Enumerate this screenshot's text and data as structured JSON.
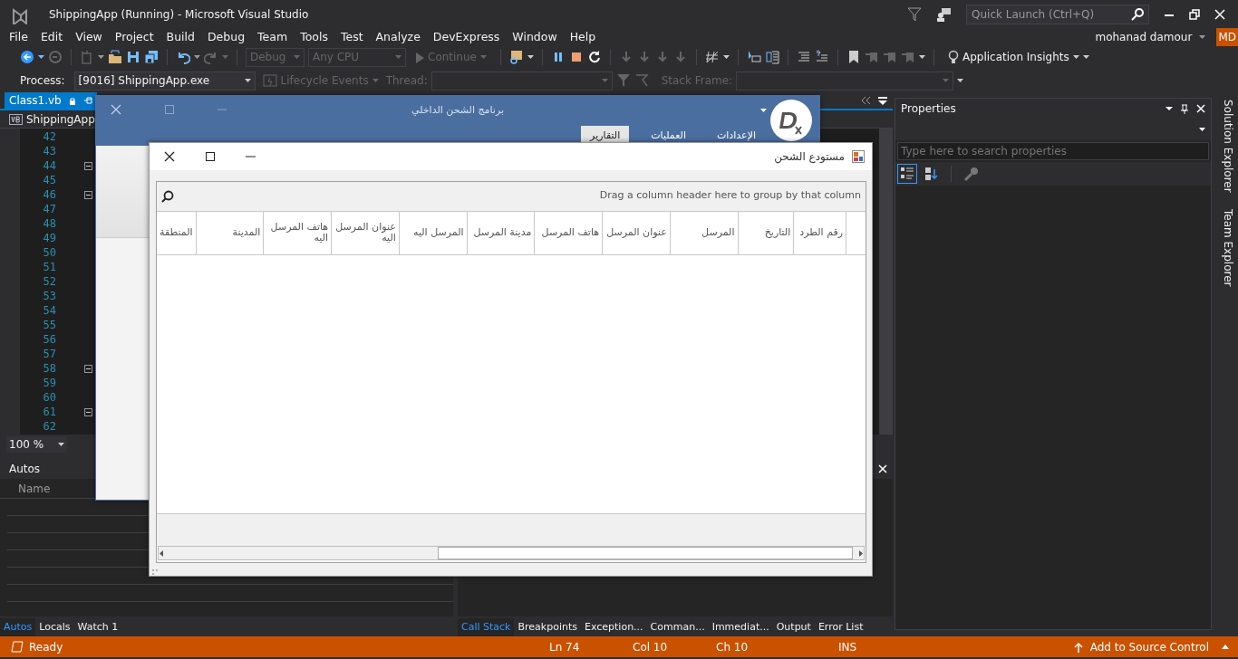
{
  "vs": {
    "title": "ShippingApp (Running) - Microsoft Visual Studio",
    "quick_launch": {
      "placeholder": "Quick Launch (Ctrl+Q)"
    },
    "menu": [
      "File",
      "Edit",
      "View",
      "Project",
      "Build",
      "Debug",
      "Team",
      "Tools",
      "Test",
      "Analyze",
      "DevExpress",
      "Window",
      "Help"
    ],
    "user": {
      "name": "mohanad damour",
      "initials": "MD"
    },
    "toolbar": {
      "configuration": "Debug",
      "platform": "Any CPU",
      "continue": "Continue",
      "insights": "Application Insights"
    },
    "debug_location": {
      "process_label": "Process:",
      "process": "[9016] ShippingApp.exe",
      "lifecycle": "Lifecycle Events",
      "thread_label": "Thread:",
      "stack_frame_label": "Stack Frame:"
    }
  },
  "editor": {
    "tab": {
      "label": "Class1.vb",
      "selected": true
    },
    "project": "ShippingApp",
    "zoom": "100 %",
    "lines": [
      {
        "number": "42",
        "fold": false
      },
      {
        "number": "43",
        "fold": false
      },
      {
        "number": "44",
        "fold": true
      },
      {
        "number": "45",
        "fold": false
      },
      {
        "number": "46",
        "fold": true
      },
      {
        "number": "47",
        "fold": false
      },
      {
        "number": "48",
        "fold": false
      },
      {
        "number": "49",
        "fold": false
      },
      {
        "number": "50",
        "fold": false
      },
      {
        "number": "51",
        "fold": false
      },
      {
        "number": "52",
        "fold": false
      },
      {
        "number": "53",
        "fold": false
      },
      {
        "number": "54",
        "fold": false
      },
      {
        "number": "55",
        "fold": false
      },
      {
        "number": "56",
        "fold": false
      },
      {
        "number": "57",
        "fold": false
      },
      {
        "number": "58",
        "fold": true
      },
      {
        "number": "59",
        "fold": false
      },
      {
        "number": "60",
        "fold": false
      },
      {
        "number": "61",
        "fold": true
      },
      {
        "number": "62",
        "fold": false
      }
    ]
  },
  "autos": {
    "title": "Autos",
    "columns": [
      "Name"
    ],
    "tabs": [
      {
        "label": "Autos",
        "selected": true
      },
      {
        "label": "Locals",
        "selected": false
      },
      {
        "label": "Watch 1",
        "selected": false
      }
    ]
  },
  "bottom_tabs": [
    {
      "label": "Call Stack",
      "selected": true
    },
    {
      "label": "Breakpoints",
      "selected": false
    },
    {
      "label": "Exception...",
      "selected": false
    },
    {
      "label": "Comman...",
      "selected": false
    },
    {
      "label": "Immediat...",
      "selected": false
    },
    {
      "label": "Output",
      "selected": false
    },
    {
      "label": "Error List",
      "selected": false
    }
  ],
  "properties": {
    "title": "Properties",
    "search": {
      "placeholder": "Type here to search properties"
    }
  },
  "side_tabs": [
    "Solution Explorer",
    "Team Explorer"
  ],
  "status_bar": {
    "state": "Ready",
    "line": "Ln 74",
    "col": "Col 10",
    "ch": "Ch 10",
    "mode": "INS",
    "source_control": "Add to Source Control"
  },
  "app_window": {
    "title": "برنامج الشحن الداخلي",
    "ribbon_tabs": [
      {
        "label": "الإعدادات",
        "selected": false
      },
      {
        "label": "العمليات",
        "selected": false
      },
      {
        "label": "التقارير",
        "selected": true
      }
    ]
  },
  "dialog": {
    "title": "مستودع الشحن",
    "group_panel": "Drag a column header here to group by that column",
    "columns": [
      "رقم الطرد",
      "التاريخ",
      "المرسل",
      "عنوان المرسل",
      "هاتف المرسل",
      "مدينة المرسل",
      "المرسل اليه",
      "عنوان المرسل اليه",
      "هاتف المرسل اليه",
      "المدينة",
      "المنطقة"
    ]
  }
}
